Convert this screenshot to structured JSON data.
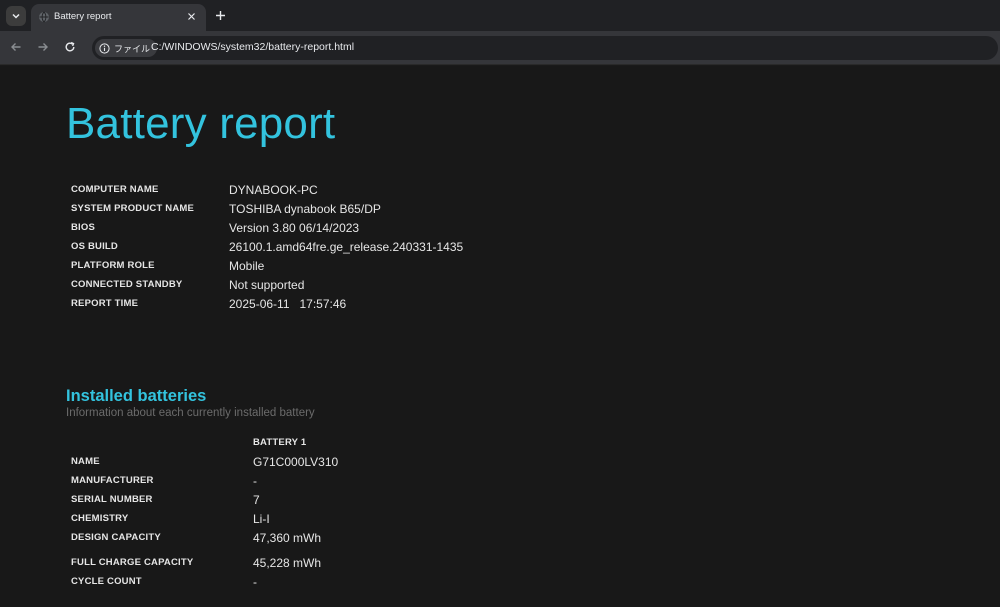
{
  "browser": {
    "tab_title": "Battery report",
    "chip_label": "ファイル",
    "url": "C:/WINDOWS/system32/battery-report.html"
  },
  "report": {
    "title": "Battery report",
    "info": [
      {
        "label": "COMPUTER NAME",
        "value": "DYNABOOK-PC"
      },
      {
        "label": "SYSTEM PRODUCT NAME",
        "value": "TOSHIBA dynabook B65/DP"
      },
      {
        "label": "BIOS",
        "value": "Version 3.80 06/14/2023"
      },
      {
        "label": "OS BUILD",
        "value": "26100.1.amd64fre.ge_release.240331-1435"
      },
      {
        "label": "PLATFORM ROLE",
        "value": "Mobile"
      },
      {
        "label": "CONNECTED STANDBY",
        "value": "Not supported"
      },
      {
        "label": "REPORT TIME",
        "value": "2025-06-11   17:57:46"
      }
    ]
  },
  "installed_batteries": {
    "title": "Installed batteries",
    "subtitle": "Information about each currently installed battery",
    "column_header": "BATTERY 1",
    "rows": [
      {
        "label": "NAME",
        "value": "G71C000LV310"
      },
      {
        "label": "MANUFACTURER",
        "value": "-"
      },
      {
        "label": "SERIAL NUMBER",
        "value": "7"
      },
      {
        "label": "CHEMISTRY",
        "value": "Li-I"
      },
      {
        "label": "DESIGN CAPACITY",
        "value": "47,360 mWh"
      },
      {
        "label": "FULL CHARGE CAPACITY",
        "value": "45,228 mWh"
      },
      {
        "label": "CYCLE COUNT",
        "value": "-"
      }
    ]
  },
  "colors": {
    "accent": "#33c3de",
    "background": "#181818"
  },
  "icons": [
    "tab-search-chevron-icon",
    "globe-icon",
    "close-icon",
    "plus-icon",
    "back-arrow-icon",
    "forward-arrow-icon",
    "reload-icon",
    "info-circle-icon"
  ]
}
